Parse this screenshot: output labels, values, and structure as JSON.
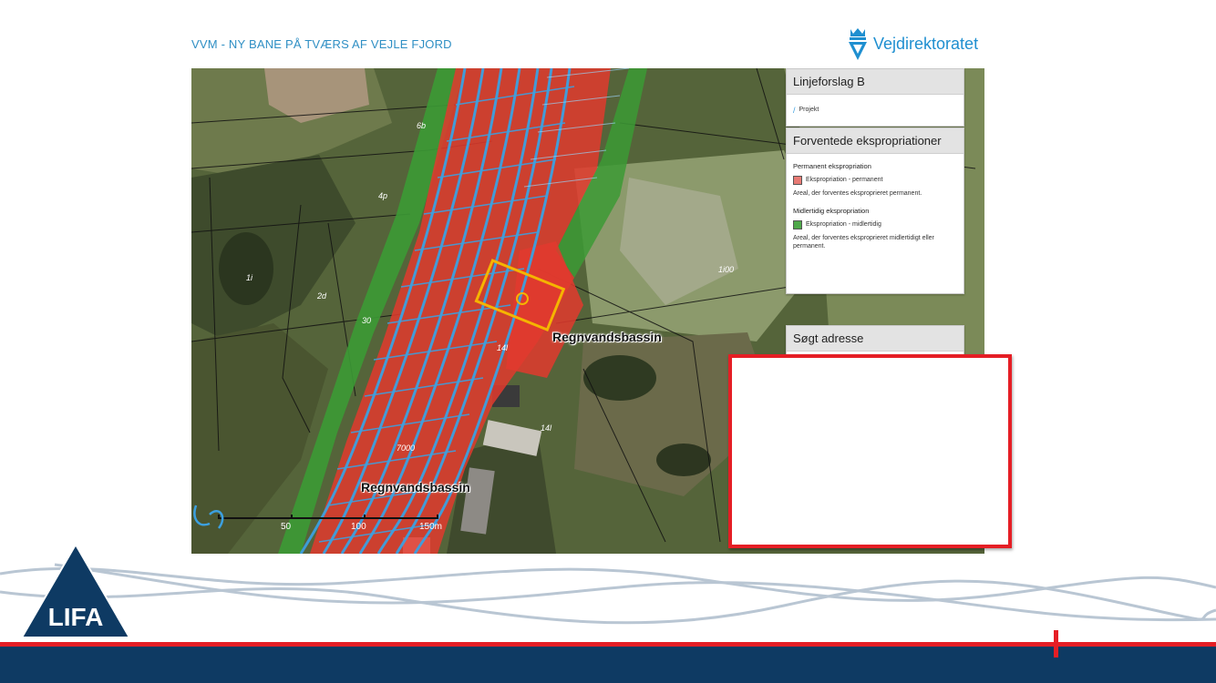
{
  "header": {
    "title": "VVM - NY BANE PÅ TVÆRS AF VEJLE FJORD",
    "brand_name": "Vejdirektoratet"
  },
  "map": {
    "labels": [
      "Regnvandsbassin",
      "Regnvandsbassin"
    ],
    "parcel_numbers": [
      "6b",
      "4p",
      "2d",
      "1i",
      "30",
      "14l",
      "7000",
      "14l",
      "1i00"
    ],
    "scale_ticks": [
      "50",
      "100",
      "150m"
    ]
  },
  "legend": {
    "layer_panel_title": "Linjeforslag B",
    "layer_item": "Projekt",
    "expropriation_panel_title": "Forventede ekspropriationer",
    "permanent_heading": "Permanent ekspropriation",
    "permanent_item": "Ekspropriation - permanent",
    "permanent_desc": "Areal, der forventes eksproprieret permanent.",
    "temporary_heading": "Midlertidig ekspropriation",
    "temporary_item": "Ekspropriation - midlertidig",
    "temporary_desc": "Areal, der forventes eksproprieret midlertidigt eller permanent.",
    "address_panel_title": "Søgt adresse"
  },
  "footer": {
    "logo_text": "LIFA"
  },
  "colors": {
    "title_blue": "#2f8fc4",
    "brand_blue": "#1f8fd0",
    "permanent_red": "#e23a2e",
    "temporary_green": "#3c9a35",
    "project_blue": "#3ca0e0",
    "highlight_yellow": "#f5b400",
    "footer_navy": "#0e3a63",
    "accent_red": "#e51e25"
  }
}
